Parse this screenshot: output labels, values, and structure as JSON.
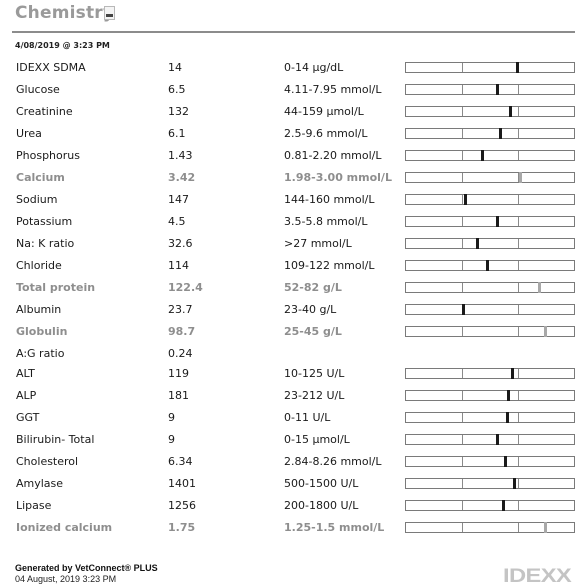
{
  "header": {
    "title": "Chemistry",
    "icon": "printer-icon",
    "datetime": "4/08/2019 @ 3:23 PM"
  },
  "results": [
    {
      "name": "IDEXX SDMA",
      "value": "14",
      "range": "0-14 µg/dL",
      "abnormal": false,
      "marker_fraction": 0.66
    },
    {
      "name": "Glucose",
      "value": "6.5",
      "range": "4.11-7.95 mmol/L",
      "abnormal": false,
      "marker_fraction": 0.54
    },
    {
      "name": "Creatinine",
      "value": "132",
      "range": "44-159 µmol/L",
      "abnormal": false,
      "marker_fraction": 0.62
    },
    {
      "name": "Urea",
      "value": "6.1",
      "range": "2.5-9.6 mmol/L",
      "abnormal": false,
      "marker_fraction": 0.56
    },
    {
      "name": "Phosphorus",
      "value": "1.43",
      "range": "0.81-2.20 mmol/L",
      "abnormal": false,
      "marker_fraction": 0.45
    },
    {
      "name": "Calcium",
      "value": "3.42",
      "range": "1.98-3.00 mmol/L",
      "abnormal": true,
      "marker_fraction": 0.68
    },
    {
      "name": "Sodium",
      "value": "147",
      "range": "144-160 mmol/L",
      "abnormal": false,
      "marker_fraction": 0.35
    },
    {
      "name": "Potassium",
      "value": "4.5",
      "range": "3.5-5.8 mmol/L",
      "abnormal": false,
      "marker_fraction": 0.54
    },
    {
      "name": "Na: K ratio",
      "value": "32.6",
      "range": ">27 mmol/L",
      "abnormal": false,
      "marker_fraction": 0.42
    },
    {
      "name": "Chloride",
      "value": "114",
      "range": "109-122 mmol/L",
      "abnormal": false,
      "marker_fraction": 0.48
    },
    {
      "name": "Total protein",
      "value": "122.4",
      "range": "52-82 g/L",
      "abnormal": true,
      "marker_fraction": 0.79
    },
    {
      "name": "Albumin",
      "value": "23.7",
      "range": "23-40 g/L",
      "abnormal": false,
      "marker_fraction": 0.34
    },
    {
      "name": "Globulin",
      "value": "98.7",
      "range": "25-45 g/L",
      "abnormal": true,
      "marker_fraction": 0.83
    },
    {
      "name": "A:G ratio",
      "value": "0.24",
      "range": "",
      "abnormal": false,
      "marker_fraction": null
    },
    {
      "name": "ALT",
      "value": "119",
      "range": "10-125 U/L",
      "abnormal": false,
      "marker_fraction": 0.63
    },
    {
      "name": "ALP",
      "value": "181",
      "range": "23-212 U/L",
      "abnormal": false,
      "marker_fraction": 0.61
    },
    {
      "name": "GGT",
      "value": "9",
      "range": "0-11 U/L",
      "abnormal": false,
      "marker_fraction": 0.6
    },
    {
      "name": "Bilirubin- Total",
      "value": "9",
      "range": "0-15 µmol/L",
      "abnormal": false,
      "marker_fraction": 0.54
    },
    {
      "name": "Cholesterol",
      "value": "6.34",
      "range": "2.84-8.26 mmol/L",
      "abnormal": false,
      "marker_fraction": 0.59
    },
    {
      "name": "Amylase",
      "value": "1401",
      "range": "500-1500 U/L",
      "abnormal": false,
      "marker_fraction": 0.64
    },
    {
      "name": "Lipase",
      "value": "1256",
      "range": "200-1800 U/L",
      "abnormal": false,
      "marker_fraction": 0.58
    },
    {
      "name": "Ionized calcium",
      "value": "1.75",
      "range": "1.25-1.5 mmol/L",
      "abnormal": true,
      "marker_fraction": 0.83
    }
  ],
  "footer": {
    "generated_by": "Generated by VetConnect® PLUS",
    "generated_date": "04 August, 2019 3:23 PM",
    "logo": "IDEXX"
  }
}
